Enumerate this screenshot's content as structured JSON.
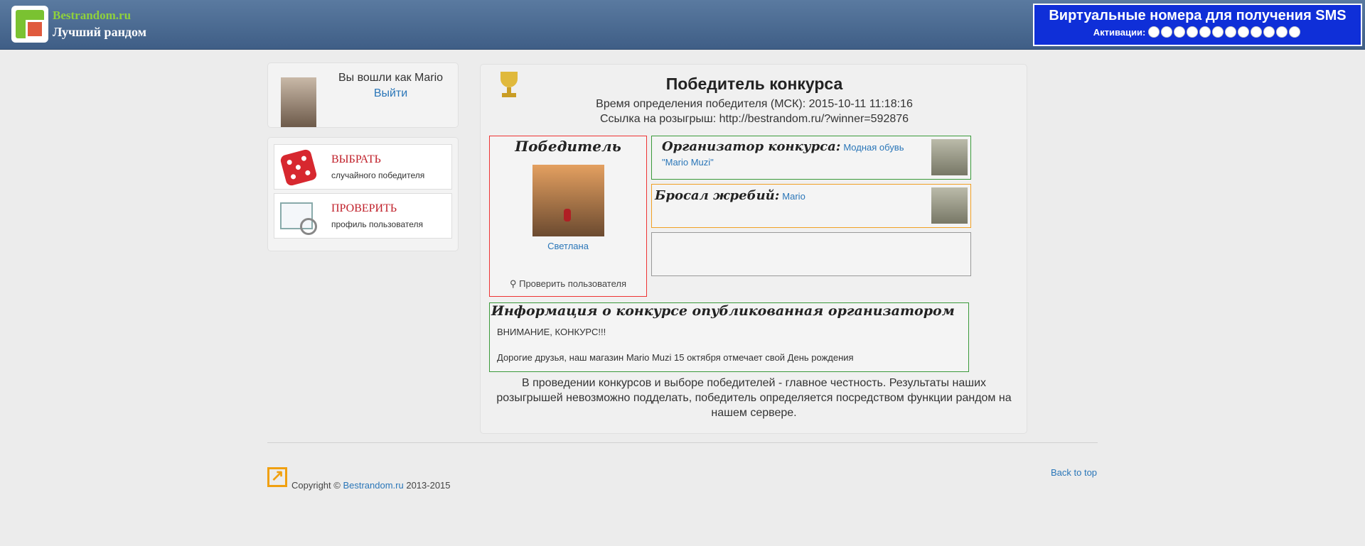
{
  "header": {
    "site_name": "Bestrandom.ru",
    "tagline": "Лучший рандом",
    "banner_title": "Виртуальные номера для получения SMS",
    "banner_activations": "Активации:"
  },
  "sidebar": {
    "logged_in_as": "Вы вошли как Mario",
    "logout": "Выйти",
    "items": [
      {
        "title": "ВЫБРАТЬ",
        "subtitle": "случайного победителя"
      },
      {
        "title": "ПРОВЕРИТЬ",
        "subtitle": "профиль пользователя"
      }
    ]
  },
  "main": {
    "title": "Победитель конкурса",
    "time_label": "Время определения победителя (МСК): 2015-10-11 11:18:16",
    "link_label": "Ссылка на розыгрыш: http://bestrandom.ru/?winner=592876",
    "winner": {
      "heading": "Победитель",
      "name": "Светлана",
      "check_user": "Проверить пользователя"
    },
    "organizer": {
      "heading": "Организатор конкурса:",
      "name": "Модная обувь \"Mario Muzi\""
    },
    "thrower": {
      "heading": "Бросал жребий:",
      "name": "Mario"
    },
    "info": {
      "heading": "Информация о конкурсе опубликованная организатором",
      "line1": "ВНИМАНИЕ, КОНКУРС!!!",
      "line2": "Дорогие друзья, наш магазин Mario Muzi 15 октября отмечает свой День рождения"
    },
    "note": "В проведении конкурсов и выборе победителей - главное честность. Результаты наших розыгрышей невозможно подделать, победитель определяется посредством функции рандом на нашем сервере."
  },
  "footer": {
    "copyright_prefix": "Copyright ©",
    "copyright_link": "Bestrandom.ru",
    "copyright_years": "2013-2015",
    "back_to_top": "Back to top"
  },
  "colors": {
    "header": "#4a6a92",
    "link": "#2a76b8",
    "menu_title": "#c0202a",
    "winner_border": "#ee3333",
    "organizer_border": "#3a9a3a",
    "thrower_border": "#f1a024"
  }
}
